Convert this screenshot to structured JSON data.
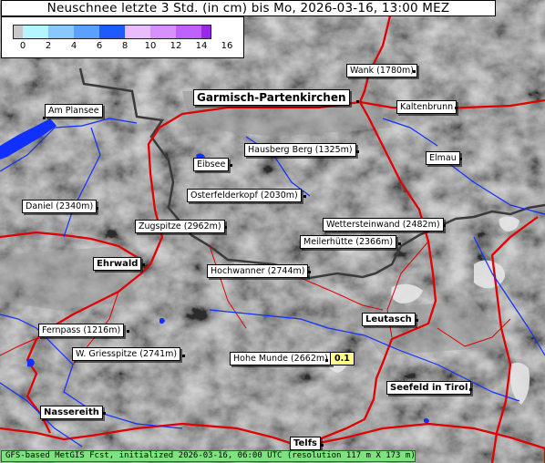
{
  "title": "Neuschnee letzte 3 Std. (in cm) bis Mo, 2026-03-16, 13:00 MEZ",
  "legend": {
    "ticks": [
      "0",
      "2",
      "4",
      "6",
      "8",
      "10",
      "12",
      "14",
      "16"
    ],
    "colors": [
      "#c8c8c8",
      "#b4f5ff",
      "#88c8ff",
      "#5aa0ff",
      "#1e5aff",
      "#e8bcff",
      "#d690ff",
      "#c060ff",
      "#9a28e8"
    ]
  },
  "places": [
    {
      "name": "Wank (1780m)",
      "kind": "peak"
    },
    {
      "name": "Garmisch-Partenkirchen",
      "kind": "major"
    },
    {
      "name": "Kaltenbrunn",
      "kind": "peak"
    },
    {
      "name": "Am Plansee",
      "kind": "peak"
    },
    {
      "name": "Hausberg Berg (1325m)",
      "kind": "peak"
    },
    {
      "name": "Eibsee",
      "kind": "peak"
    },
    {
      "name": "Elmau",
      "kind": "peak"
    },
    {
      "name": "Osterfelderkopf (2030m)",
      "kind": "peak"
    },
    {
      "name": "Daniel (2340m)",
      "kind": "peak"
    },
    {
      "name": "Zugspitze (2962m)",
      "kind": "peak"
    },
    {
      "name": "Wettersteinwand (2482m)",
      "kind": "peak"
    },
    {
      "name": "Meilerhütte (2366m)",
      "kind": "peak"
    },
    {
      "name": "Ehrwald",
      "kind": "town"
    },
    {
      "name": "Hochwanner (2744m)",
      "kind": "peak"
    },
    {
      "name": "Leutasch",
      "kind": "town"
    },
    {
      "name": "Fernpass (1216m)",
      "kind": "peak"
    },
    {
      "name": "W. Griesspitze (2741m)",
      "kind": "peak"
    },
    {
      "name": "Hohe Munde (2662m)",
      "kind": "peak"
    },
    {
      "name": "Seefeld in Tirol",
      "kind": "town"
    },
    {
      "name": "Nassereith",
      "kind": "town"
    },
    {
      "name": "Telfs",
      "kind": "town"
    }
  ],
  "values": [
    {
      "label": "0.1",
      "at": "Hohe Munde (2662m)"
    }
  ],
  "footer": "GFS-based MetGIS Fcst, initialized 2026-03-16, 06:00 UTC  (resolution 117 m X 173 m)"
}
